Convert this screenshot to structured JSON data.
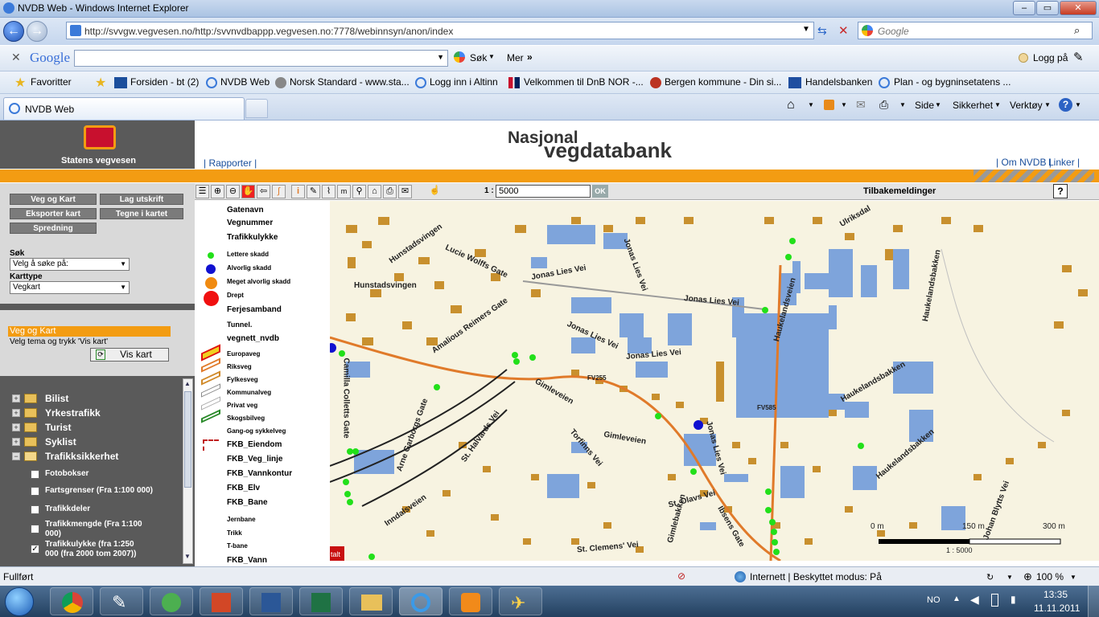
{
  "window": {
    "title": "NVDB Web - Windows Internet Explorer"
  },
  "address": {
    "url": "http://svvgw.vegvesen.no/http:/svvnvdbappp.vegvesen.no:7778/webinnsyn/anon/index",
    "search_placeholder": "Google"
  },
  "google_toolbar": {
    "logo": "Google",
    "search_label": "Søk",
    "more_label": "Mer",
    "login_label": "Logg på"
  },
  "favorites": {
    "label": "Favoritter",
    "items": [
      "Forsiden - bt (2)",
      "NVDB Web",
      "Norsk Standard - www.sta...",
      "Logg inn i Altinn",
      "Velkommen til DnB NOR -...",
      "Bergen kommune - Din si...",
      "Handelsbanken",
      "Plan - og bygninsetatens ..."
    ]
  },
  "tab": {
    "label": "NVDB Web"
  },
  "command_bar": {
    "page": "Side",
    "safety": "Sikkerhet",
    "tools": "Verktøy"
  },
  "header": {
    "org_name": "Statens vegvesen",
    "title_line1": "Nasjonal",
    "title_line2": "vegdatabank",
    "reports_link": "| Rapporter |",
    "about_link": "| Om NVDB |",
    "links_link": "Linker |"
  },
  "left": {
    "buttons": [
      "Veg og Kart",
      "Lag utskrift",
      "Eksporter kart",
      "Tegne i kartet",
      "Spredning"
    ],
    "search_label": "Søk",
    "search_select": "Velg å søke på:",
    "maptype_label": "Karttype",
    "maptype_select": "Vegkart",
    "section_title": "Veg og Kart",
    "section_hint": "Velg tema og trykk 'Vis kart'",
    "show_map": "Vis kart",
    "tree": [
      "Bilist",
      "Yrkestrafikk",
      "Turist",
      "Syklist",
      "Trafikksikkerhet"
    ],
    "subitems": [
      {
        "label": "Fotobokser",
        "checked": false
      },
      {
        "label": "Fartsgrenser (Fra 1:100 000)",
        "checked": false
      },
      {
        "label": "Trafikkdeler",
        "checked": false
      },
      {
        "label": "Trafikkmengde (Fra 1:100",
        "label2": "000)",
        "checked": false
      },
      {
        "label": "Trafikkulykke (fra 1:250",
        "label2": "000 (fra 2000 tom 2007))",
        "checked": true
      }
    ]
  },
  "toolbar": {
    "scale_prefix": "1 :",
    "scale_value": "5000",
    "ok": "OK",
    "feedback": "Tilbakemeldinger",
    "help": "?"
  },
  "legend": [
    "Gatenavn",
    "Vegnummer",
    "Trafikkulykke",
    "Lettere skadd",
    "Alvorlig skadd",
    "Meget alvorlig skadd",
    "Drept",
    "Ferjesamband",
    "Tunnel.",
    "vegnett_nvdb",
    "Europaveg",
    "Riksveg",
    "Fylkesveg",
    "Kommunalveg",
    "Privat veg",
    "Skogsbilveg",
    "Gang-og sykkelveg",
    "FKB_Eiendom",
    "FKB_Veg_linje",
    "FKB_Vannkontur",
    "FKB_Elv",
    "FKB_Bane",
    "Jernbane",
    "Trikk",
    "T-bane",
    "FKB_Vann"
  ],
  "map": {
    "streets": [
      "Ulriksdal",
      "Hunstadsvingen",
      "Lucie Wolffs Gate",
      "Jonas Lies Vei",
      "Jonas Lies Vei",
      "Hunstadsvingen",
      "Jonas Lies Vei",
      "Amalious Reimers Gate",
      "Jonas Lies Vei",
      "Jonas Lies Vei",
      "Haukelandsveien",
      "Haukelandsbakken",
      "Haukelandsbakken",
      "FV255",
      "Gimleveien",
      "Gimleveien",
      "FV585",
      "Jonas Lies Vei",
      "St. Olavs Vei",
      "Torfinns Vei",
      "St. Halvards Vei",
      "Arne Garborgs Gate",
      "Inndalsveien",
      "Gimlebakken",
      "Ibsens Gate",
      "St. Clemens' Vei",
      "Johan Blytts Vei",
      "Haukelandsbakken",
      "Camilla Colletts Gate"
    ],
    "scale_labels": [
      "0 m",
      "150 m",
      "300 m"
    ],
    "scale_text": "1 : 5000",
    "corner_tag": "talt",
    "colors": {
      "background": "#f7f3e1",
      "building_brown": "#c8902e",
      "building_blue": "#7ea4db",
      "road_orange": "#e07a2a",
      "accident_green": "#22e01a",
      "accident_blue": "#1010d0"
    }
  },
  "status": {
    "left": "Fullført",
    "zone": "Internett | Beskyttet modus: På",
    "zoom": "100 %"
  },
  "taskbar": {
    "lang": "NO",
    "time": "13:35",
    "date": "11.11.2011"
  }
}
